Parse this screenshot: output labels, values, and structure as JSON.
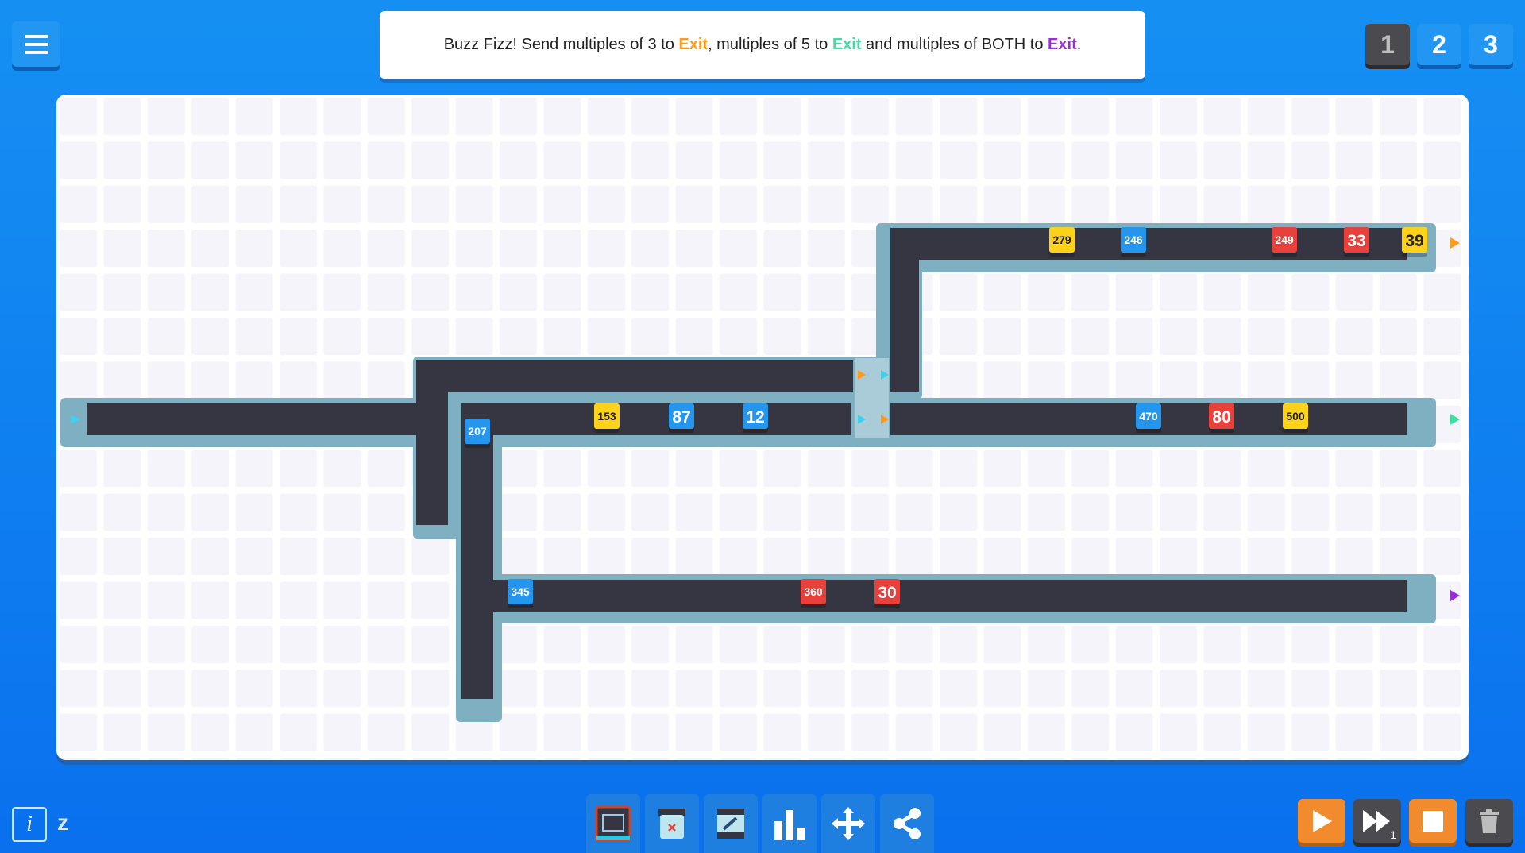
{
  "menu": {
    "icon": "hamburger-menu-icon"
  },
  "instructions": {
    "part1": "Buzz Fizz! Send multiples of 3 to ",
    "exit1": "Exit",
    "part2": ", multiples of 5 to ",
    "exit2": "Exit",
    "part3": " and multiples of BOTH to ",
    "exit3": "Exit",
    "part4": ".",
    "colors": {
      "exit1": "#ff9a1a",
      "exit2": "#3de0a2",
      "exit3": "#9b2be0"
    }
  },
  "levels": [
    "1",
    "2",
    "3"
  ],
  "current_level": "1",
  "tokens": [
    {
      "value": "279",
      "color": "yellow"
    },
    {
      "value": "246",
      "color": "blue"
    },
    {
      "value": "249",
      "color": "red"
    },
    {
      "value": "33",
      "color": "red"
    },
    {
      "value": "39",
      "color": "yellow"
    },
    {
      "value": "207",
      "color": "blue"
    },
    {
      "value": "153",
      "color": "yellow"
    },
    {
      "value": "87",
      "color": "blue"
    },
    {
      "value": "12",
      "color": "blue"
    },
    {
      "value": "470",
      "color": "blue"
    },
    {
      "value": "80",
      "color": "red"
    },
    {
      "value": "500",
      "color": "yellow"
    },
    {
      "value": "345",
      "color": "blue"
    },
    {
      "value": "360",
      "color": "red"
    },
    {
      "value": "30",
      "color": "red"
    }
  ],
  "token_colors": {
    "yellow": "#ffd21a",
    "blue": "#2596ee",
    "red": "#e8403b"
  },
  "info_label": "i",
  "hotkey_label": "z",
  "toolbar": [
    {
      "name": "conveyor-tool",
      "icon": "conveyor-icon"
    },
    {
      "name": "trash-bin-tool",
      "icon": "bin-icon"
    },
    {
      "name": "sensor-tool",
      "icon": "sensor-icon"
    },
    {
      "name": "stats-tool",
      "icon": "bar-chart-icon"
    },
    {
      "name": "move-tool",
      "icon": "move-arrows-icon"
    },
    {
      "name": "share-tool",
      "icon": "share-icon"
    }
  ],
  "controls": {
    "fast_forward_multiplier": "1"
  }
}
